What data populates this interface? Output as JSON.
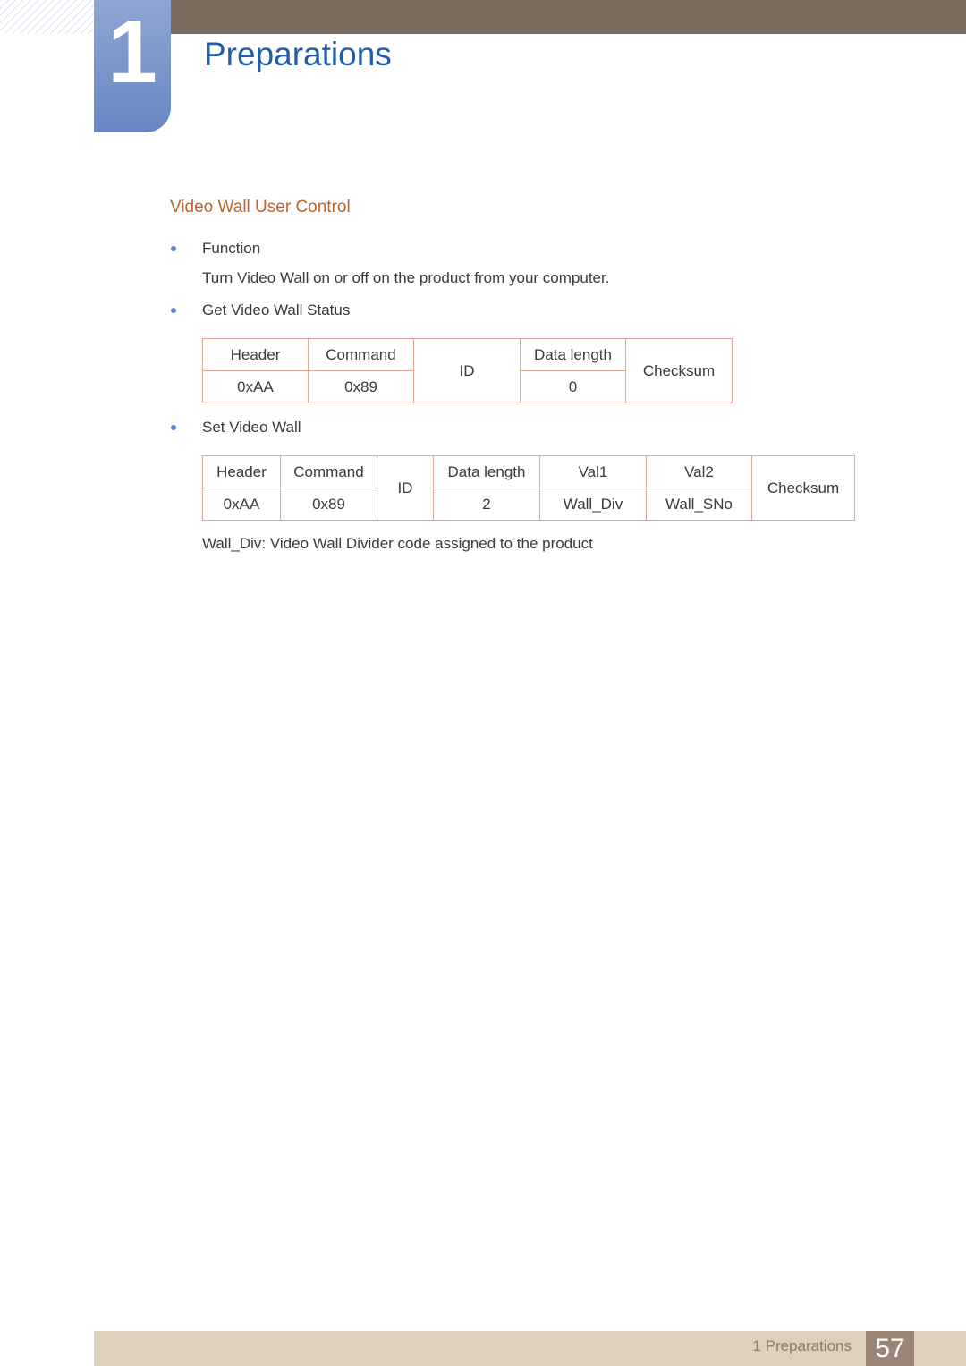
{
  "header": {
    "chapter_number": "1",
    "chapter_title": "Preparations"
  },
  "section": {
    "title": "Video Wall User Control",
    "items": [
      {
        "label": "Function",
        "description": "Turn Video Wall on or off on the product from your computer."
      },
      {
        "label": "Get Video Wall Status"
      },
      {
        "label": "Set Video Wall"
      }
    ]
  },
  "get_table": {
    "headers": [
      "Header",
      "Command",
      "ID",
      "Data length",
      "Checksum"
    ],
    "values": [
      "0xAA",
      "0x89",
      "0"
    ]
  },
  "set_table": {
    "headers": [
      "Header",
      "Command",
      "ID",
      "Data length",
      "Val1",
      "Val2",
      "Checksum"
    ],
    "values": [
      "0xAA",
      "0x89",
      "2",
      "Wall_Div",
      "Wall_SNo"
    ]
  },
  "note": "Wall_Div: Video Wall Divider code assigned to the product",
  "footer": {
    "label": "1 Preparations",
    "page_number": "57"
  }
}
